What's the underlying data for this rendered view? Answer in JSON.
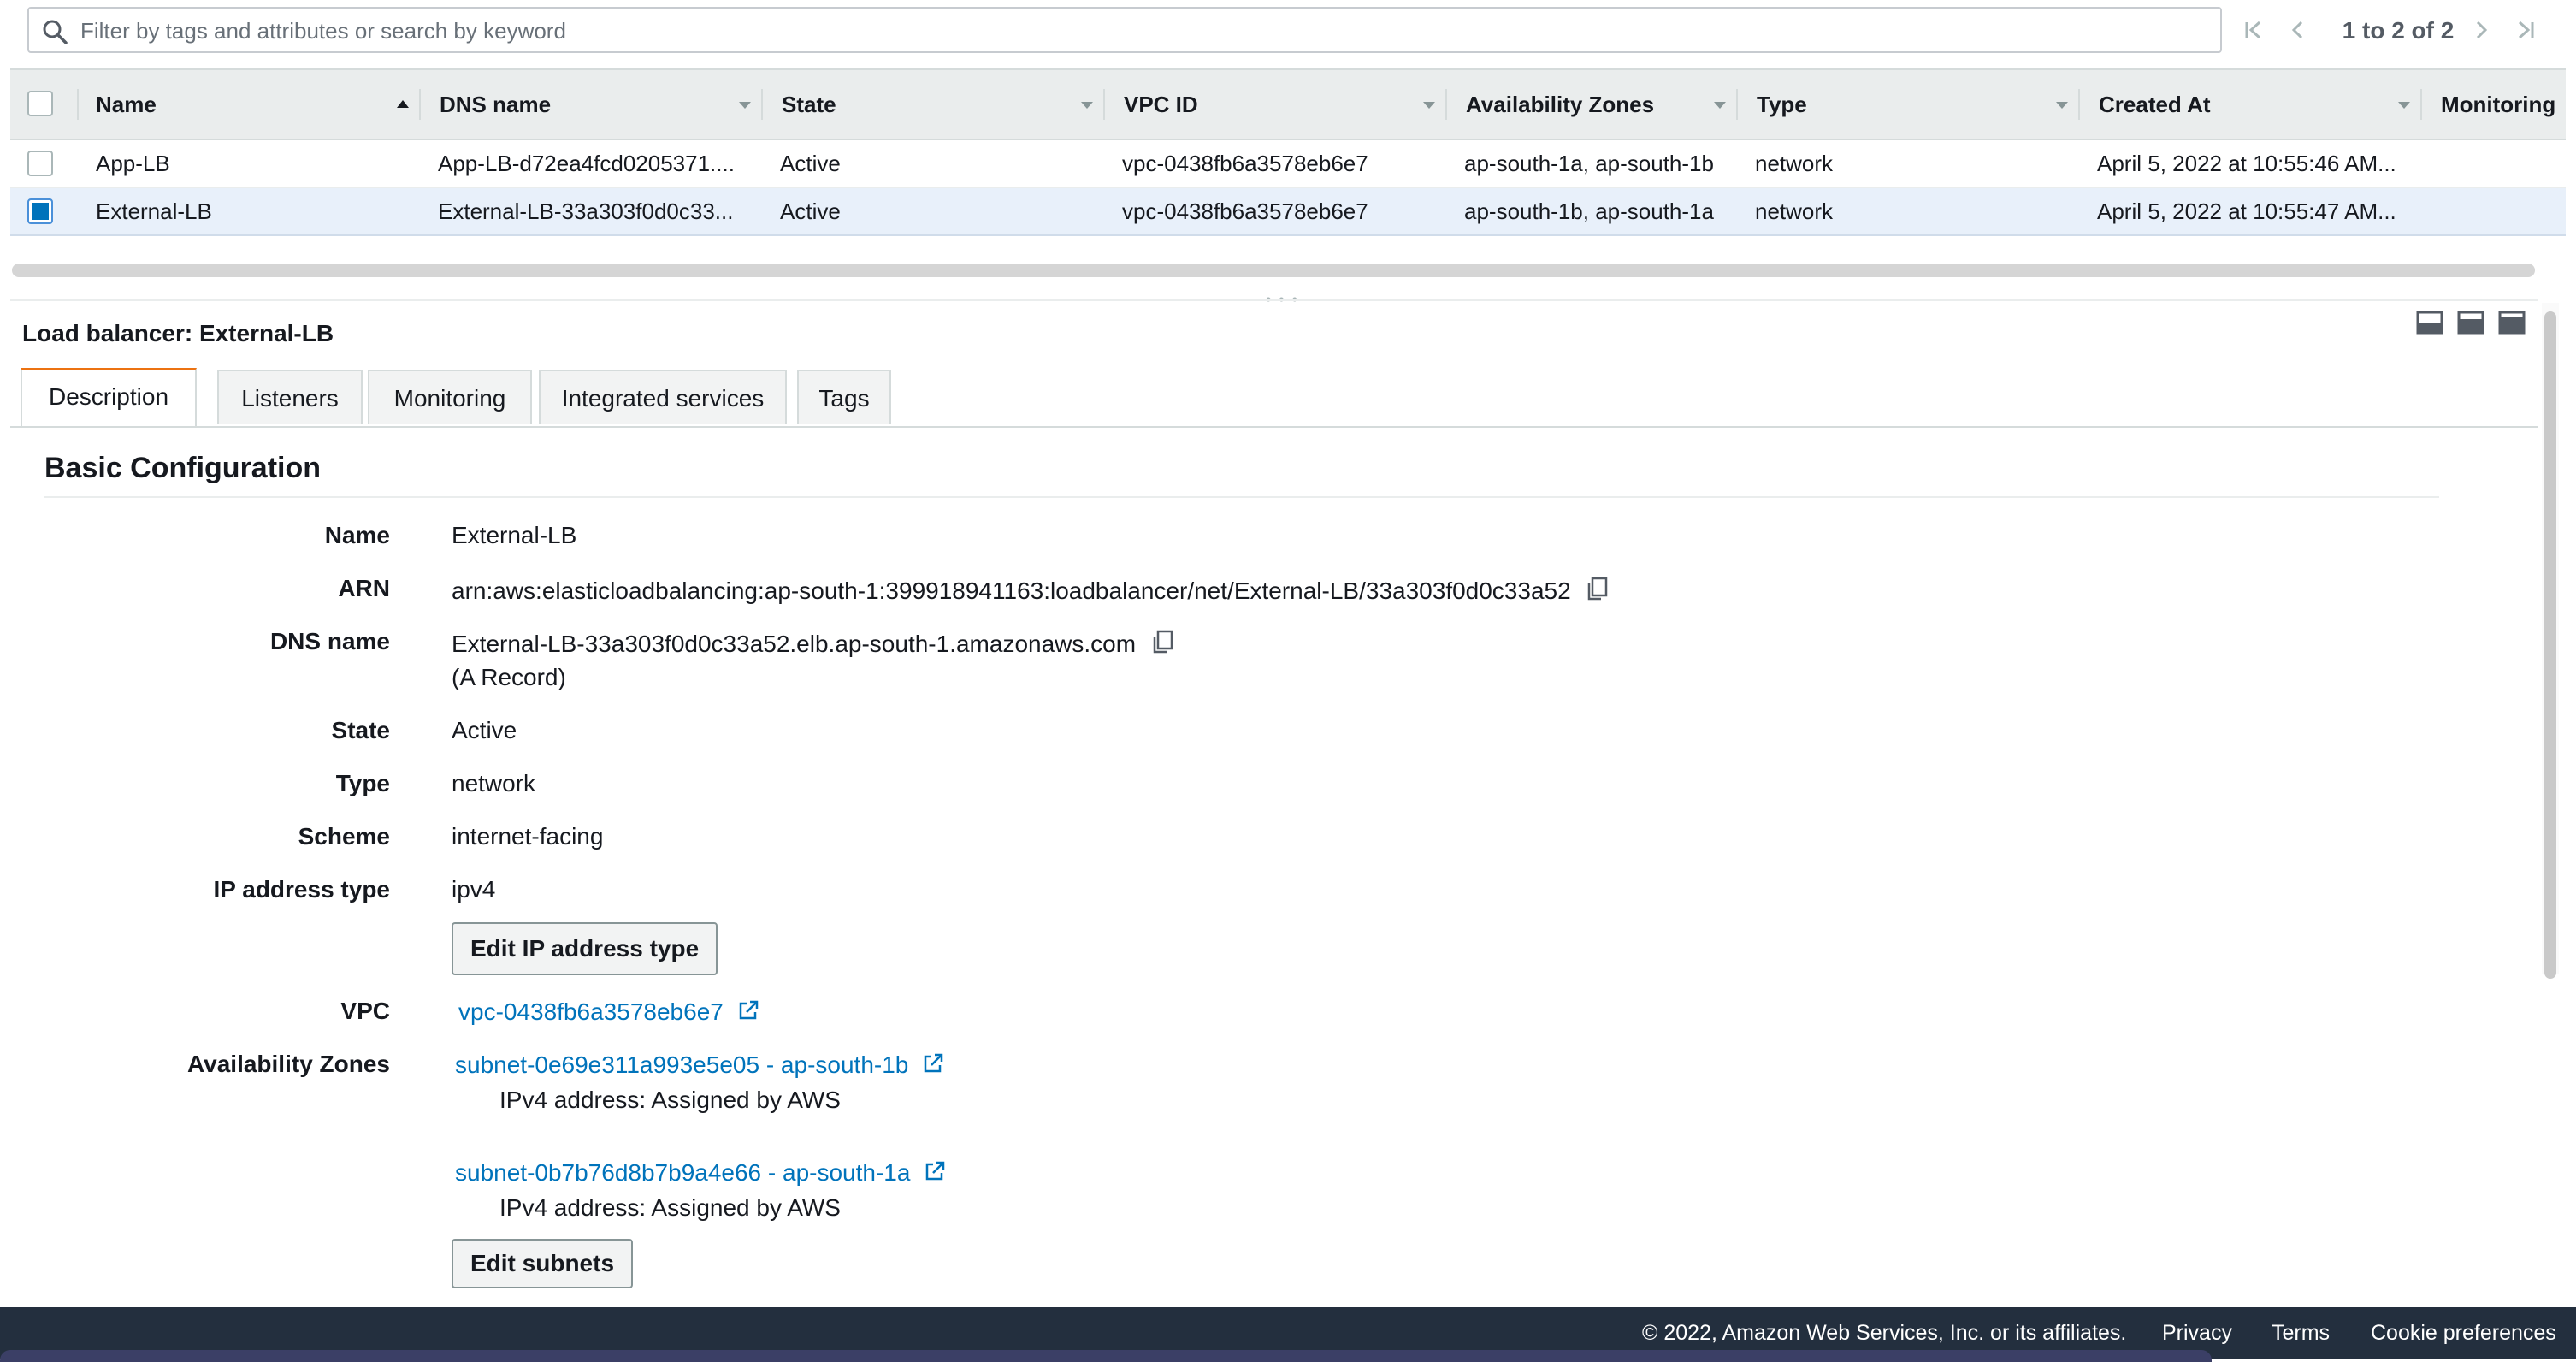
{
  "search": {
    "placeholder": "Filter by tags and attributes or search by keyword",
    "value": ""
  },
  "pagination": {
    "text": "1 to 2 of 2"
  },
  "table": {
    "columns": [
      "Name",
      "DNS name",
      "State",
      "VPC ID",
      "Availability Zones",
      "Type",
      "Created At",
      "Monitoring"
    ],
    "rows": [
      {
        "name": "App-LB",
        "dns": "App-LB-d72ea4fcd0205371....",
        "state": "Active",
        "vpc": "vpc-0438fb6a3578eb6e7",
        "azs": "ap-south-1a, ap-south-1b",
        "type": "network",
        "created": "April 5, 2022 at 10:55:46 AM...",
        "selected": false
      },
      {
        "name": "External-LB",
        "dns": "External-LB-33a303f0d0c33...",
        "state": "Active",
        "vpc": "vpc-0438fb6a3578eb6e7",
        "azs": "ap-south-1b, ap-south-1a",
        "type": "network",
        "created": "April 5, 2022 at 10:55:47 AM...",
        "selected": true
      }
    ]
  },
  "panel": {
    "title": "Load balancer: External-LB",
    "tabs": [
      "Description",
      "Listeners",
      "Monitoring",
      "Integrated services",
      "Tags"
    ],
    "section_title": "Basic Configuration",
    "labels": {
      "name": "Name",
      "arn": "ARN",
      "dns": "DNS name",
      "state": "State",
      "type": "Type",
      "scheme": "Scheme",
      "ip_type": "IP address type",
      "vpc": "VPC",
      "azs": "Availability Zones"
    },
    "values": {
      "name": "External-LB",
      "arn": "arn:aws:elasticloadbalancing:ap-south-1:399918941163:loadbalancer/net/External-LB/33a303f0d0c33a52",
      "dns": "External-LB-33a303f0d0c33a52.elb.ap-south-1.amazonaws.com",
      "dns_record": "(A Record)",
      "state": "Active",
      "type": "network",
      "scheme": "internet-facing",
      "ip_type": "ipv4",
      "vpc": "vpc-0438fb6a3578eb6e7",
      "subnets": [
        {
          "link": "subnet-0e69e311a993e5e05 - ap-south-1b",
          "ipv4": "IPv4 address: Assigned by AWS"
        },
        {
          "link": "subnet-0b7b76d8b7b9a4e66 - ap-south-1a",
          "ipv4": "IPv4 address: Assigned by AWS"
        }
      ]
    },
    "buttons": {
      "edit_ip_type": "Edit IP address type",
      "edit_subnets": "Edit subnets"
    }
  },
  "footer": {
    "copyright": "© 2022, Amazon Web Services, Inc. or its affiliates.",
    "privacy": "Privacy",
    "terms": "Terms",
    "cookies": "Cookie preferences"
  },
  "colors": {
    "link": "#0073bb",
    "active_tab_accent": "#ec7211",
    "selected_row": "#e8f0fa",
    "footer_bg": "#232f3e"
  }
}
